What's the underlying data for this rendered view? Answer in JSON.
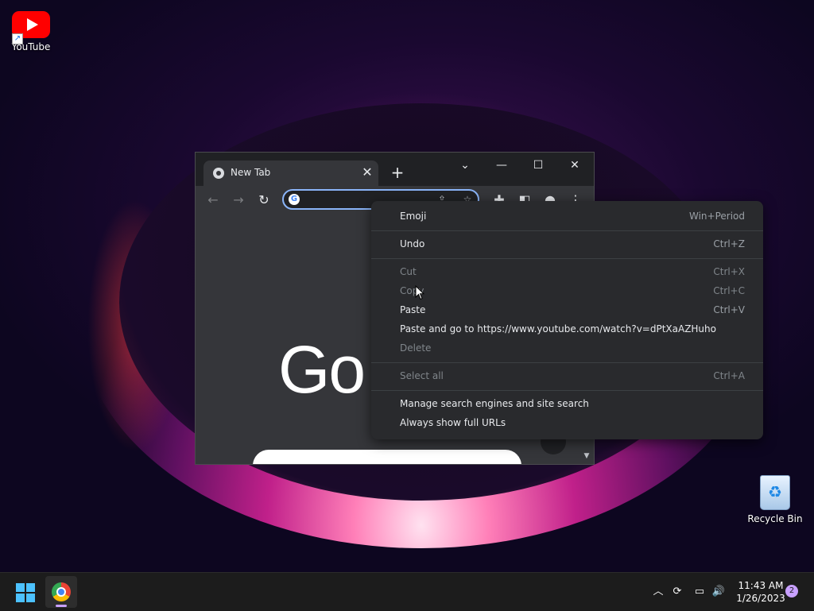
{
  "desktop": {
    "icons": [
      {
        "label": "YouTube"
      },
      {
        "label": "Recycle Bin"
      }
    ]
  },
  "browser": {
    "tab_title": "New Tab",
    "tab_close": "✕",
    "new_tab": "+",
    "window_controls": {
      "tab_search": "⌄",
      "minimize": "—",
      "maximize": "☐",
      "close": "✕"
    },
    "toolbar": {
      "back": "←",
      "forward": "→",
      "reload": "↻",
      "extensions": "✚",
      "side_panel": "◧",
      "profile": "●",
      "menu": "⋮"
    },
    "omnibox": {
      "value": "",
      "share": "⇪",
      "bookmark": "☆"
    },
    "content": {
      "logo_text": "Go"
    }
  },
  "context_menu": {
    "items": [
      {
        "label": "Emoji",
        "shortcut": "Win+Period",
        "enabled": true
      },
      {
        "label": "Undo",
        "shortcut": "Ctrl+Z",
        "enabled": true
      },
      {
        "label": "Cut",
        "shortcut": "Ctrl+X",
        "enabled": false
      },
      {
        "label": "Copy",
        "shortcut": "Ctrl+C",
        "enabled": false
      },
      {
        "label": "Paste",
        "shortcut": "Ctrl+V",
        "enabled": true
      },
      {
        "label": "Paste and go to https://www.youtube.com/watch?v=dPtXaAZHuho",
        "shortcut": "",
        "enabled": true
      },
      {
        "label": "Delete",
        "shortcut": "",
        "enabled": false
      },
      {
        "label": "Select all",
        "shortcut": "Ctrl+A",
        "enabled": false
      },
      {
        "label": "Manage search engines and site search",
        "shortcut": "",
        "enabled": true
      },
      {
        "label": "Always show full URLs",
        "shortcut": "",
        "enabled": true
      }
    ]
  },
  "taskbar": {
    "tray": {
      "chevron": "︿",
      "sync": "⟳",
      "network": "▭",
      "volume": "🔊"
    },
    "clock": {
      "time": "11:43 AM",
      "date": "1/26/2023"
    },
    "notifications": "2"
  },
  "colors": {
    "accent": "#8ab4f8",
    "youtube_red": "#ff0000",
    "menu_bg": "#292a2d",
    "taskbar_bg": "#1c1c1c"
  }
}
